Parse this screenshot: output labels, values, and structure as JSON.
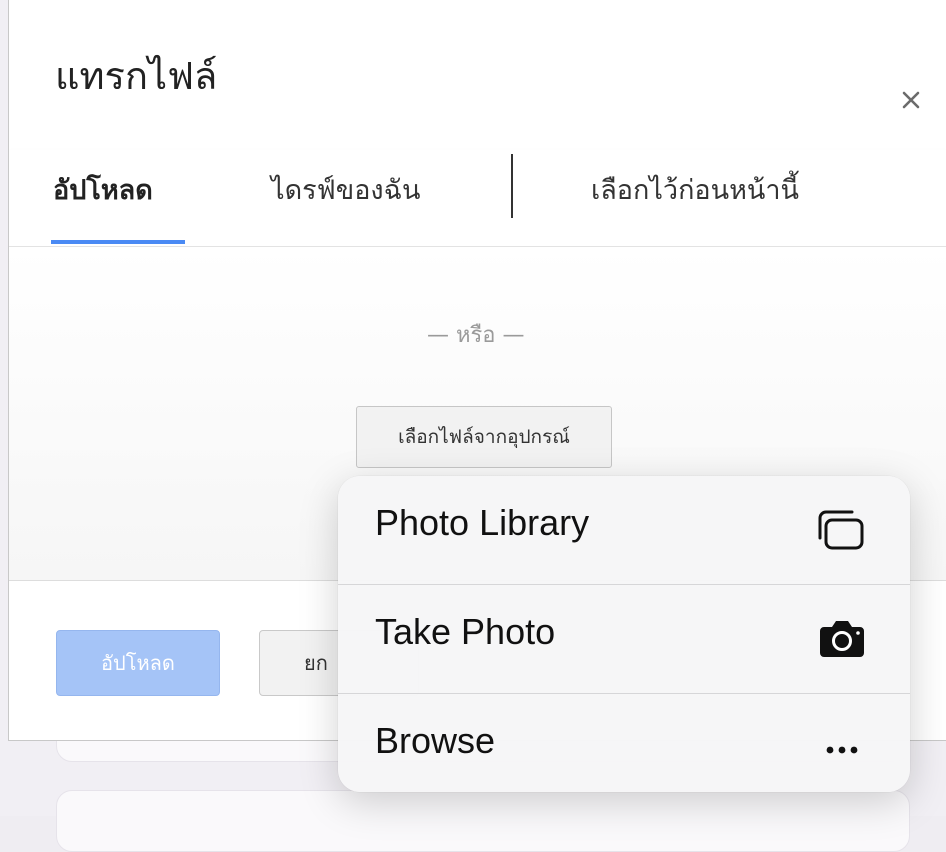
{
  "dialog": {
    "title": "แทรกไฟล์",
    "close_symbol": "×",
    "close_icon": "close-icon"
  },
  "tabs": [
    {
      "label": "อัปโหลด",
      "active": true
    },
    {
      "label": "ไดรฟ์ของฉัน",
      "active": false
    },
    {
      "label": "เลือกไว้ก่อนหน้านี้",
      "active": false
    }
  ],
  "upload_area": {
    "hidden_text": "",
    "or_label": "— หรือ —",
    "choose_file_label": "เลือกไฟล์จากอุปกรณ์"
  },
  "footer": {
    "upload_label": "อัปโหลด",
    "cancel_label": "ยก"
  },
  "ios_menu": {
    "items": [
      {
        "label": "Photo Library",
        "icon": "photo-library-icon"
      },
      {
        "label": "Take Photo",
        "icon": "camera-icon"
      },
      {
        "label": "Browse",
        "icon": "more-icon"
      }
    ]
  },
  "colors": {
    "accent": "#4a8af4",
    "upload_disabled": "#a5c4f7"
  }
}
